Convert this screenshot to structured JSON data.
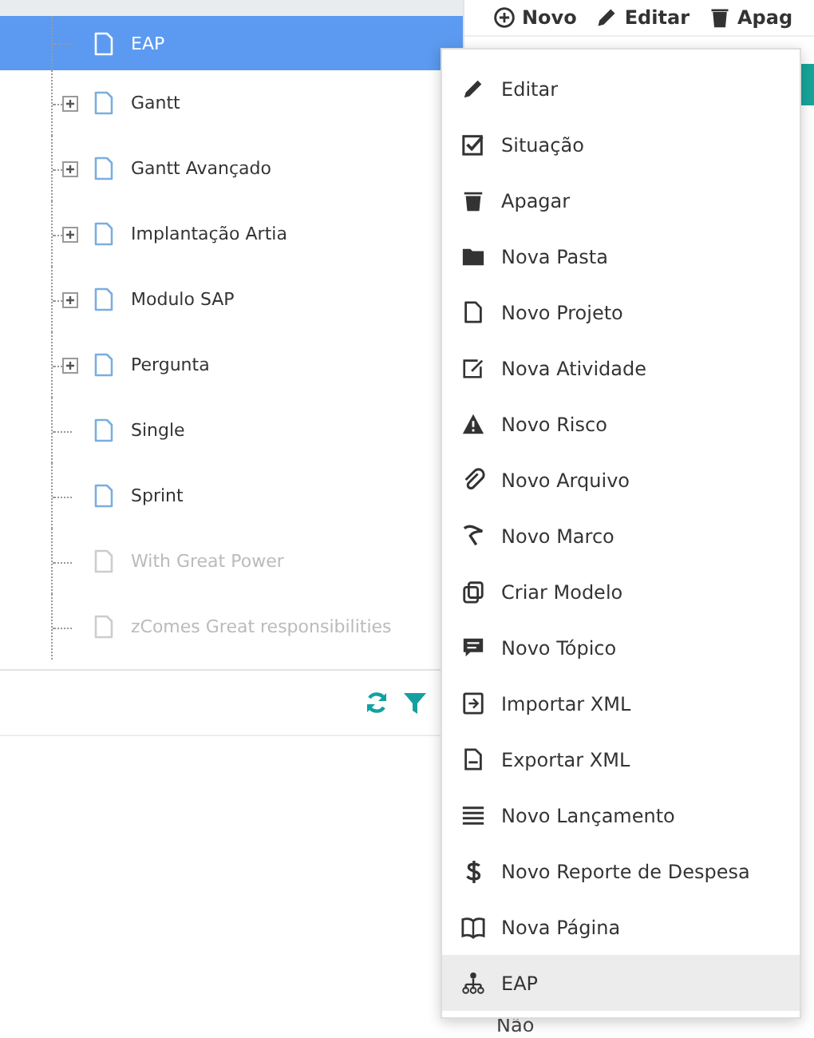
{
  "toolbar": [
    {
      "kind": "plus",
      "label": "Novo"
    },
    {
      "kind": "pencil",
      "label": "Editar"
    },
    {
      "kind": "trash",
      "label": "Apag"
    }
  ],
  "tree": [
    {
      "label": "EAP",
      "selected": true,
      "kind": "leaf",
      "disabled": false
    },
    {
      "label": "Gantt",
      "selected": false,
      "kind": "expandable",
      "disabled": false
    },
    {
      "label": "Gantt Avançado",
      "selected": false,
      "kind": "expandable",
      "disabled": false
    },
    {
      "label": "Implantação Artia",
      "selected": false,
      "kind": "expandable",
      "disabled": false
    },
    {
      "label": "Modulo SAP",
      "selected": false,
      "kind": "expandable",
      "disabled": false
    },
    {
      "label": "Pergunta",
      "selected": false,
      "kind": "expandable",
      "disabled": false
    },
    {
      "label": "Single",
      "selected": false,
      "kind": "leaf",
      "disabled": false
    },
    {
      "label": "Sprint",
      "selected": false,
      "kind": "leaf",
      "disabled": false
    },
    {
      "label": "With Great Power",
      "selected": false,
      "kind": "leaf",
      "disabled": true
    },
    {
      "label": "zComes Great responsibilities",
      "selected": false,
      "kind": "leaf",
      "disabled": true
    }
  ],
  "context_menu": [
    {
      "kind": "pencil",
      "label": "Editar",
      "selected": false
    },
    {
      "kind": "check",
      "label": "Situação",
      "selected": false
    },
    {
      "kind": "trash",
      "label": "Apagar",
      "selected": false
    },
    {
      "kind": "folder",
      "label": "Nova Pasta",
      "selected": false
    },
    {
      "kind": "file",
      "label": "Novo Projeto",
      "selected": false
    },
    {
      "kind": "edit",
      "label": "Nova Atividade",
      "selected": false
    },
    {
      "kind": "warning",
      "label": "Novo Risco",
      "selected": false
    },
    {
      "kind": "paperclip",
      "label": "Novo Arquivo",
      "selected": false
    },
    {
      "kind": "flag",
      "label": "Novo Marco",
      "selected": false
    },
    {
      "kind": "copy",
      "label": "Criar Modelo",
      "selected": false
    },
    {
      "kind": "comment",
      "label": "Novo Tópico",
      "selected": false
    },
    {
      "kind": "import",
      "label": "Importar XML",
      "selected": false
    },
    {
      "kind": "export",
      "label": "Exportar XML",
      "selected": false
    },
    {
      "kind": "list",
      "label": "Novo Lançamento",
      "selected": false
    },
    {
      "kind": "dollar",
      "label": "Novo Reporte de Despesa",
      "selected": false
    },
    {
      "kind": "book",
      "label": "Nova Página",
      "selected": false
    },
    {
      "kind": "sitemap",
      "label": "EAP",
      "selected": true
    }
  ],
  "below_menu": "Não"
}
